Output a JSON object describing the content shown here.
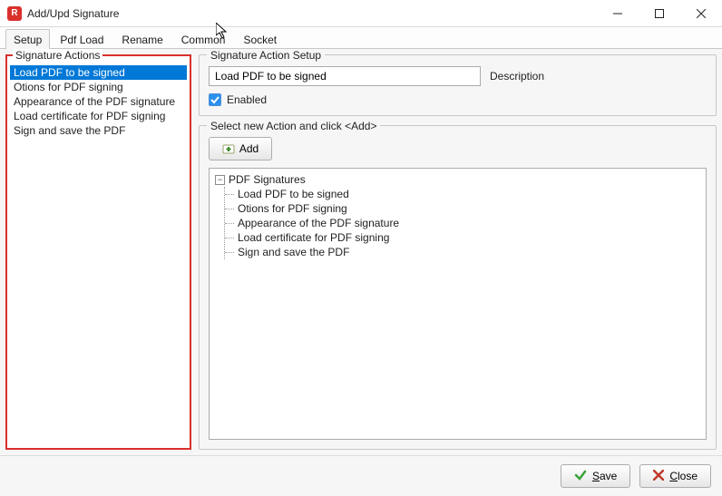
{
  "window": {
    "title": "Add/Upd Signature",
    "app_icon_letter": "R"
  },
  "tabs": [
    {
      "label": "Setup"
    },
    {
      "label": "Pdf Load"
    },
    {
      "label": "Rename"
    },
    {
      "label": "Common"
    },
    {
      "label": "Socket"
    }
  ],
  "active_tab_index": 0,
  "left_panel": {
    "title": "Signature Actions",
    "items": [
      "Load PDF to be signed",
      "Otions for PDF signing",
      "Appearance of the PDF signature",
      "Load certificate for PDF signing",
      "Sign and save the PDF"
    ],
    "selected_index": 0
  },
  "action_setup": {
    "group_label": "Signature Action Setup",
    "value": "Load PDF to be signed",
    "description_label": "Description",
    "enabled_label": "Enabled",
    "enabled_checked": true
  },
  "action_select": {
    "group_label": "Select new Action  and click  <Add>",
    "add_label": "Add",
    "tree_root": "PDF Signatures",
    "tree_items": [
      "Load PDF to be signed",
      "Otions for PDF signing",
      "Appearance of the PDF signature",
      "Load certificate for PDF signing",
      "Sign and save the PDF"
    ]
  },
  "footer": {
    "save_label": "Save",
    "close_label": "Close"
  }
}
